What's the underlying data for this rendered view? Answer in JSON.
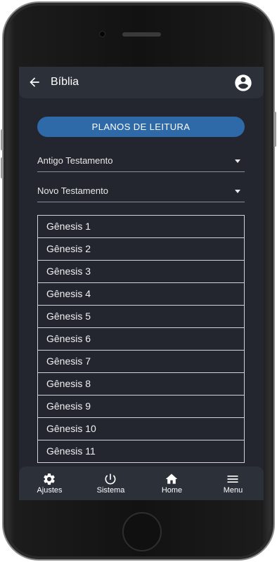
{
  "header": {
    "title": "Bíblia"
  },
  "plans_button": {
    "label": "PLANOS DE LEITURA"
  },
  "selects": [
    {
      "label": "Antigo Testamento"
    },
    {
      "label": "Novo Testamento"
    }
  ],
  "chapters": [
    "Gênesis 1",
    "Gênesis 2",
    "Gênesis 3",
    "Gênesis 4",
    "Gênesis 5",
    "Gênesis 6",
    "Gênesis 7",
    "Gênesis 8",
    "Gênesis 9",
    "Gênesis 10",
    "Gênesis 11"
  ],
  "bottom_nav": [
    {
      "label": "Ajustes",
      "icon": "gear-icon"
    },
    {
      "label": "Sistema",
      "icon": "power-icon"
    },
    {
      "label": "Home",
      "icon": "home-icon"
    },
    {
      "label": "Menu",
      "icon": "menu-icon"
    }
  ],
  "colors": {
    "screen_bg": "#23262e",
    "bar_bg": "#2c3039",
    "accent": "#2f6aa8"
  }
}
